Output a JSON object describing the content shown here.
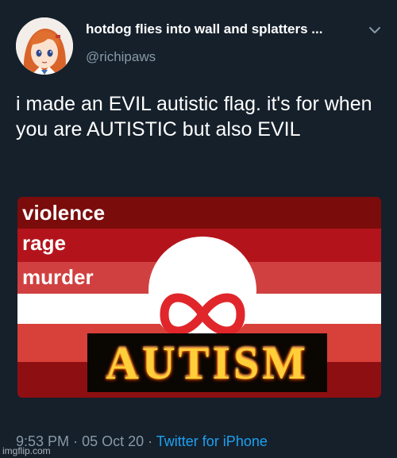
{
  "user": {
    "display_name": "hotdog flies into wall and splatters ...",
    "handle": "@richipaws",
    "avatar_icon": "anime-avatar-icon"
  },
  "tweet": {
    "text": "i made an EVIL autistic flag. it's for when you are AUTISTIC but also EVIL",
    "time": "9:53 PM",
    "date": "05 Oct 20",
    "source": "Twitter for iPhone"
  },
  "flag": {
    "labels": [
      "violence",
      "rage",
      "murder"
    ],
    "banner_text": "AUTISM",
    "colors": {
      "stripe_dark": "#7a0c0c",
      "stripe_red": "#b3141c",
      "stripe_mid": "#d14040",
      "stripe_pink": "#f0a7a2",
      "stripe_white": "#ffffff",
      "infinity": "#e0262b"
    }
  },
  "watermark": "imgflip.com",
  "colors": {
    "background": "#15202b",
    "secondary_text": "#8899a6",
    "link": "#1da1f2"
  }
}
